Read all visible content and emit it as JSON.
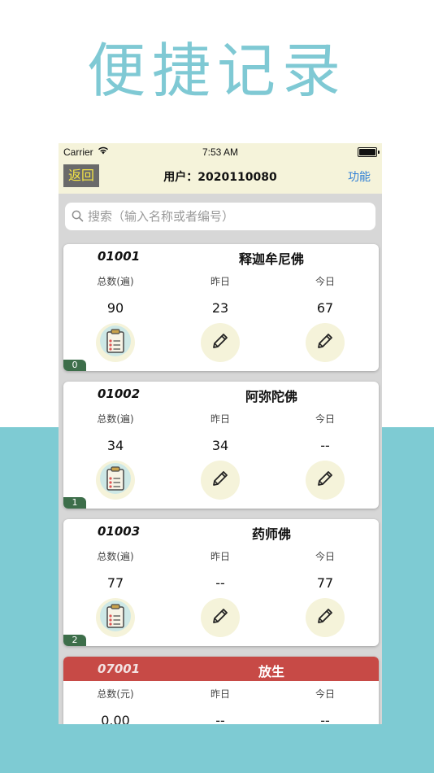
{
  "hero_title": "便捷记录",
  "status_bar": {
    "carrier": "Carrier",
    "time": "7:53 AM"
  },
  "nav": {
    "back_label": "返回",
    "title": "用户：2020110080",
    "function_label": "功能"
  },
  "search": {
    "placeholder": "搜索（输入名称或者编号）"
  },
  "cards": [
    {
      "code": "01001",
      "name": "释迦牟尼佛",
      "total_label": "总数(遍)",
      "yesterday_label": "昨日",
      "today_label": "今日",
      "total": "90",
      "yesterday": "23",
      "today": "67",
      "badge": "0"
    },
    {
      "code": "01002",
      "name": "阿弥陀佛",
      "total_label": "总数(遍)",
      "yesterday_label": "昨日",
      "today_label": "今日",
      "total": "34",
      "yesterday": "34",
      "today": "--",
      "badge": "1"
    },
    {
      "code": "01003",
      "name": "药师佛",
      "total_label": "总数(遍)",
      "yesterday_label": "昨日",
      "today_label": "今日",
      "total": "77",
      "yesterday": "--",
      "today": "77",
      "badge": "2"
    },
    {
      "code": "07001",
      "name": "放生",
      "total_label": "总数(元)",
      "yesterday_label": "昨日",
      "today_label": "今日",
      "total": "0.00",
      "yesterday": "--",
      "today": "--"
    }
  ],
  "colors": {
    "hero": "#7fc9d4",
    "teal_band": "#7ecbd3",
    "header_bg": "#f5f3da",
    "accent_blue": "#2f7fd6",
    "red_header": "#c74a46",
    "badge_green": "#3d6e4a"
  }
}
